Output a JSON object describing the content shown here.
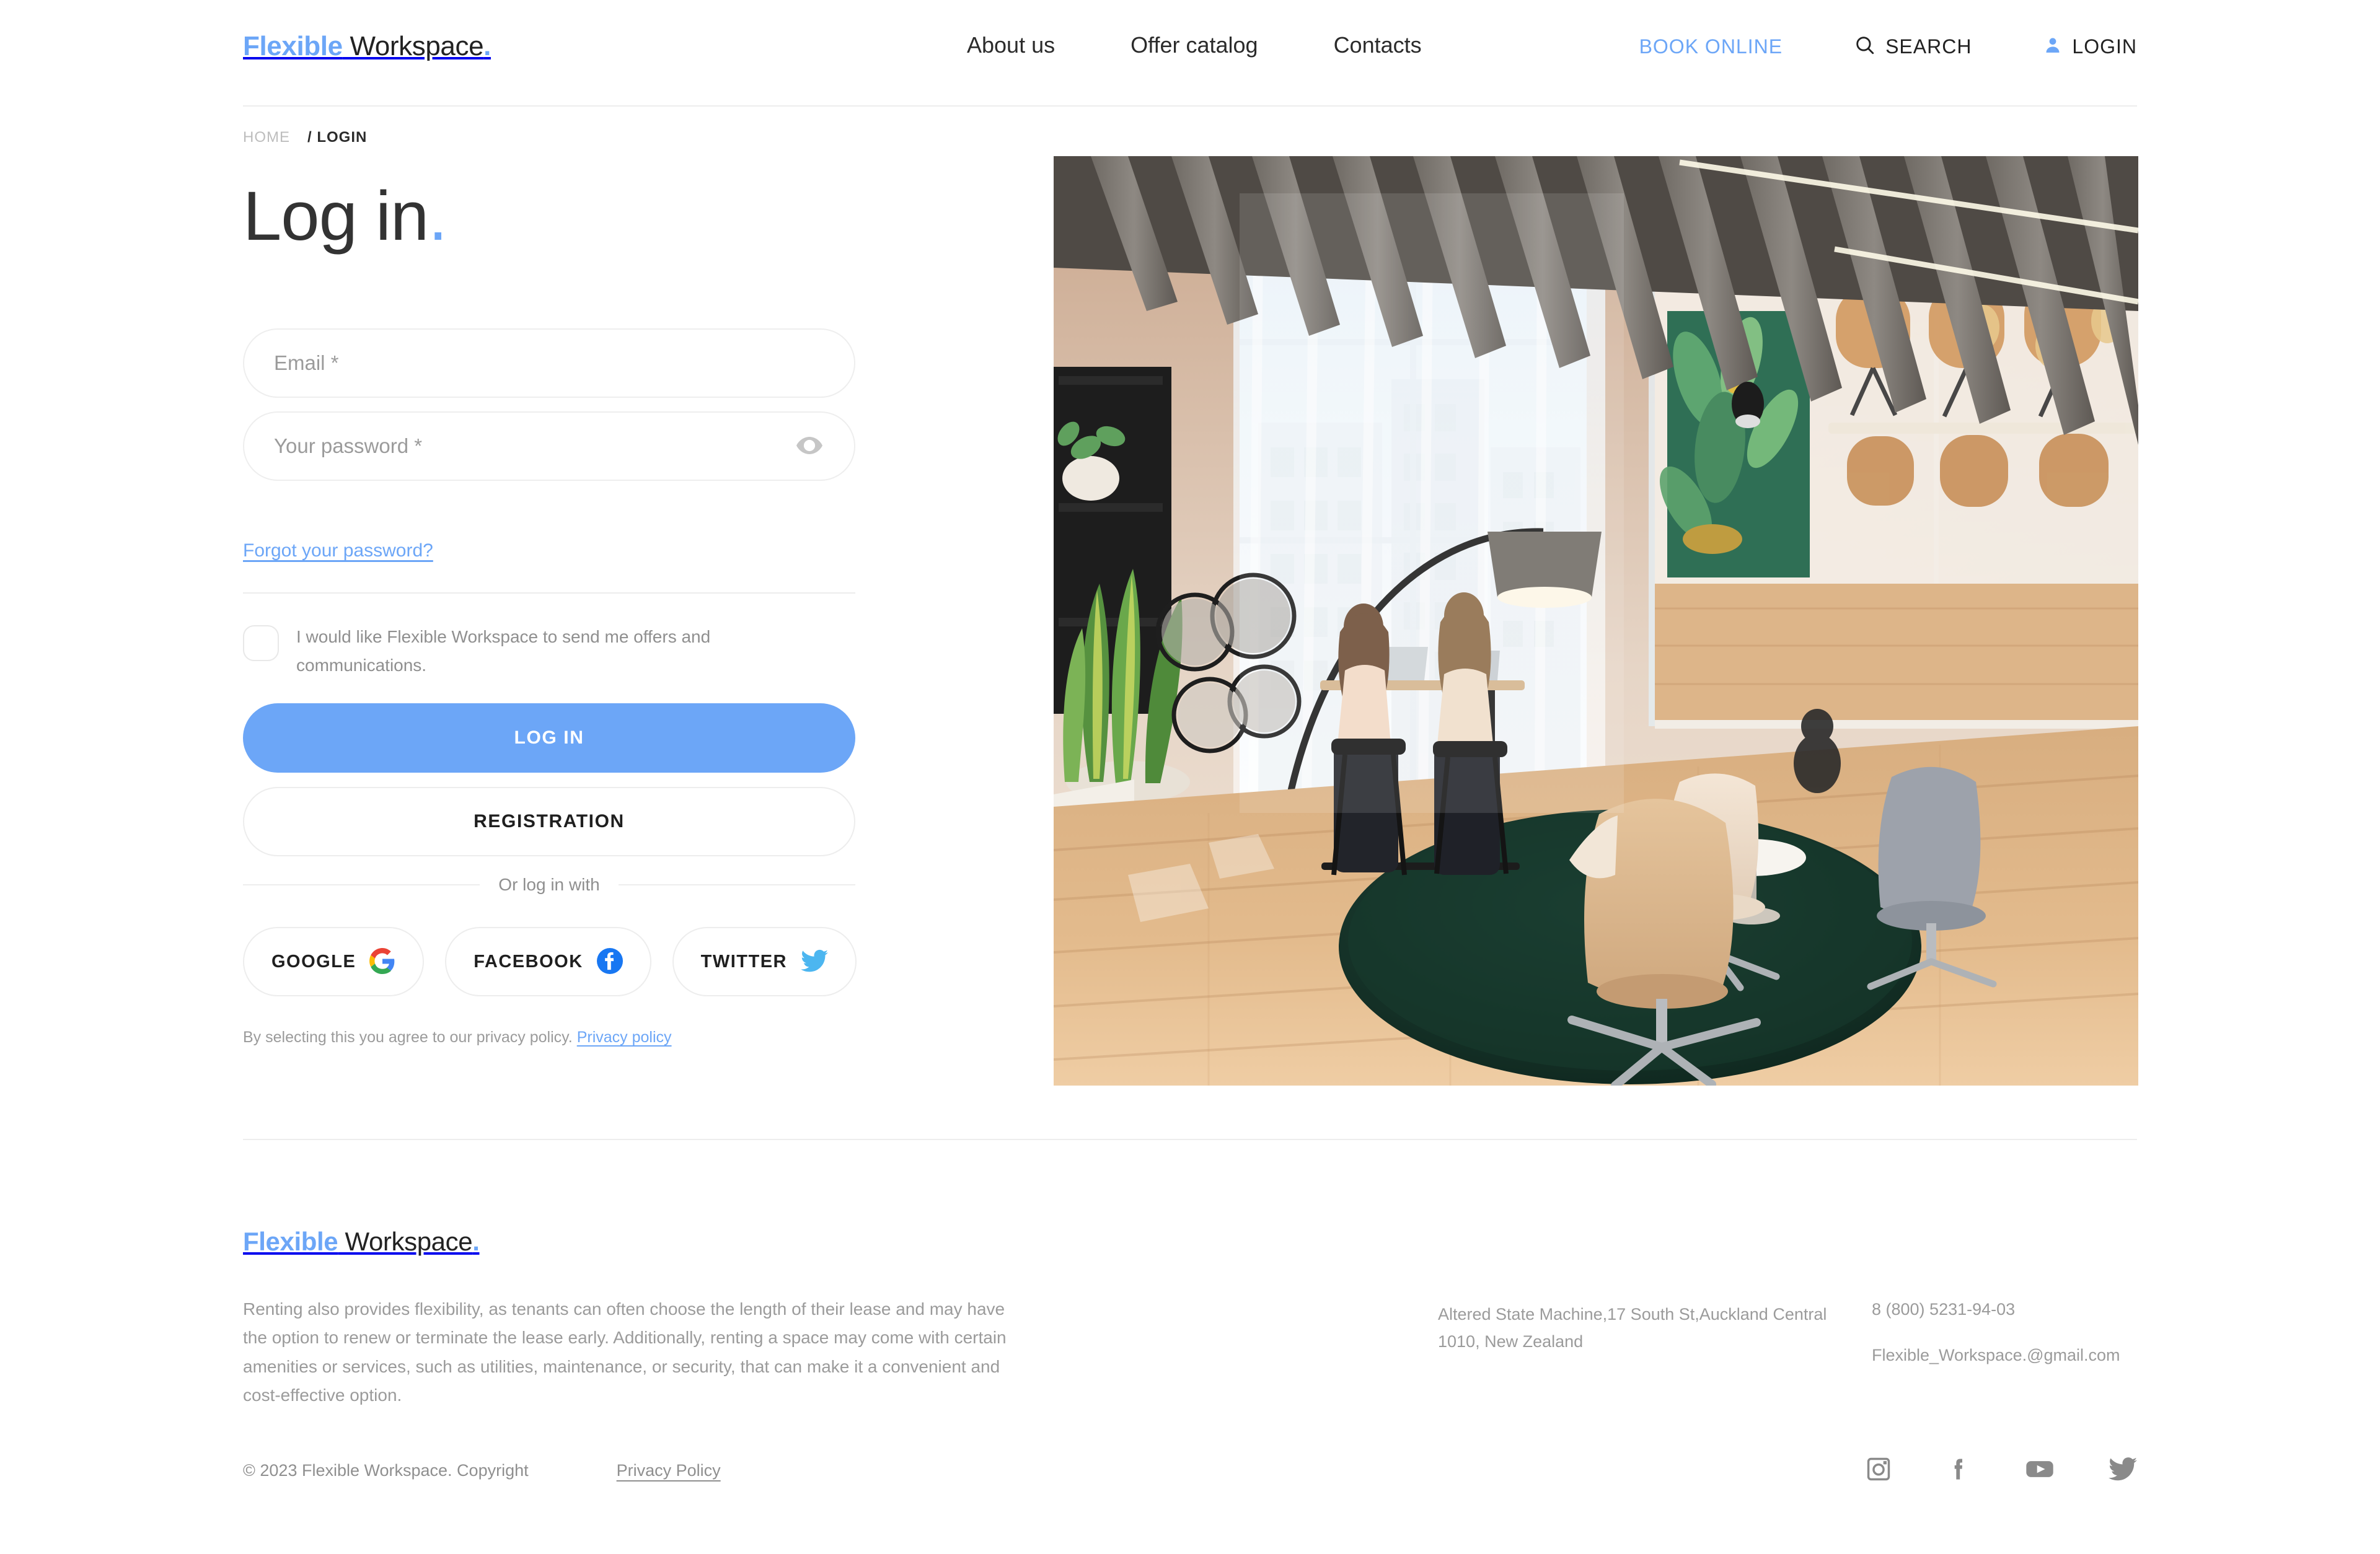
{
  "brand": {
    "first": "Flexible",
    "second": " Workspace",
    "dot": "."
  },
  "header": {
    "nav": [
      {
        "label": "About us",
        "name": "nav-about-us"
      },
      {
        "label": "Offer catalog",
        "name": "nav-offer-catalog"
      },
      {
        "label": "Contacts",
        "name": "nav-contacts"
      }
    ],
    "book_online": "BOOK ONLINE",
    "search_label": "SEARCH",
    "login_label": "LOGIN",
    "icons": {
      "search": "search-icon",
      "user": "user-icon"
    }
  },
  "breadcrumb": {
    "home": "HOME",
    "current": "/ LOGIN"
  },
  "main": {
    "title": "Log in",
    "title_dot": ".",
    "email_placeholder": "Email *",
    "email_value": "",
    "password_placeholder": "Your password *",
    "password_value": "",
    "toggle_password_icon": "eye-icon",
    "forgot_password": "Forgot your password?",
    "consent_text": "I would like Flexible Workspace to send me offers and communications.",
    "consent_checked": false,
    "login_button": "LOG IN",
    "registration_button": "REGISTRATION",
    "or_divider": "Or log in with",
    "social_buttons": [
      {
        "label": "GOOGLE",
        "icon": "google-icon",
        "name": "google-login-button"
      },
      {
        "label": "FACEBOOK",
        "icon": "facebook-icon",
        "name": "facebook-login-button"
      },
      {
        "label": "TWITTER",
        "icon": "twitter-icon",
        "name": "twitter-login-button"
      }
    ],
    "privacy_note": "By selecting this you agree to our privacy policy.",
    "privacy_link": "Privacy policy"
  },
  "hero": {
    "alt": "Modern coworking office lounge with green round rug, tan swivel chairs, large windows and people working at tables"
  },
  "footer": {
    "description": "Renting also provides flexibility, as tenants can often choose the length of their lease and may have the option to renew or terminate the lease early. Additionally, renting a space may come with certain amenities or services, such as utilities, maintenance, or security, that can make it a convenient and cost-effective option.",
    "address": "Altered State Machine,17 South St,Auckland Central 1010, New Zealand",
    "phone": "8 (800) 5231-94-03",
    "email": "Flexible_Workspace.@gmail.com",
    "copyright": "© 2023 Flexible Workspace. Copyright",
    "privacy_policy": "Privacy Policy",
    "social": [
      {
        "icon": "instagram-icon",
        "name": "social-instagram"
      },
      {
        "icon": "facebook-icon",
        "name": "social-facebook"
      },
      {
        "icon": "youtube-icon",
        "name": "social-youtube"
      },
      {
        "icon": "twitter-icon",
        "name": "social-twitter"
      }
    ]
  },
  "colors": {
    "accent": "#6ca6f7",
    "text": "#222222",
    "muted": "#9b9b9b",
    "border": "#ededed",
    "social_gray": "#8a8a8a"
  }
}
